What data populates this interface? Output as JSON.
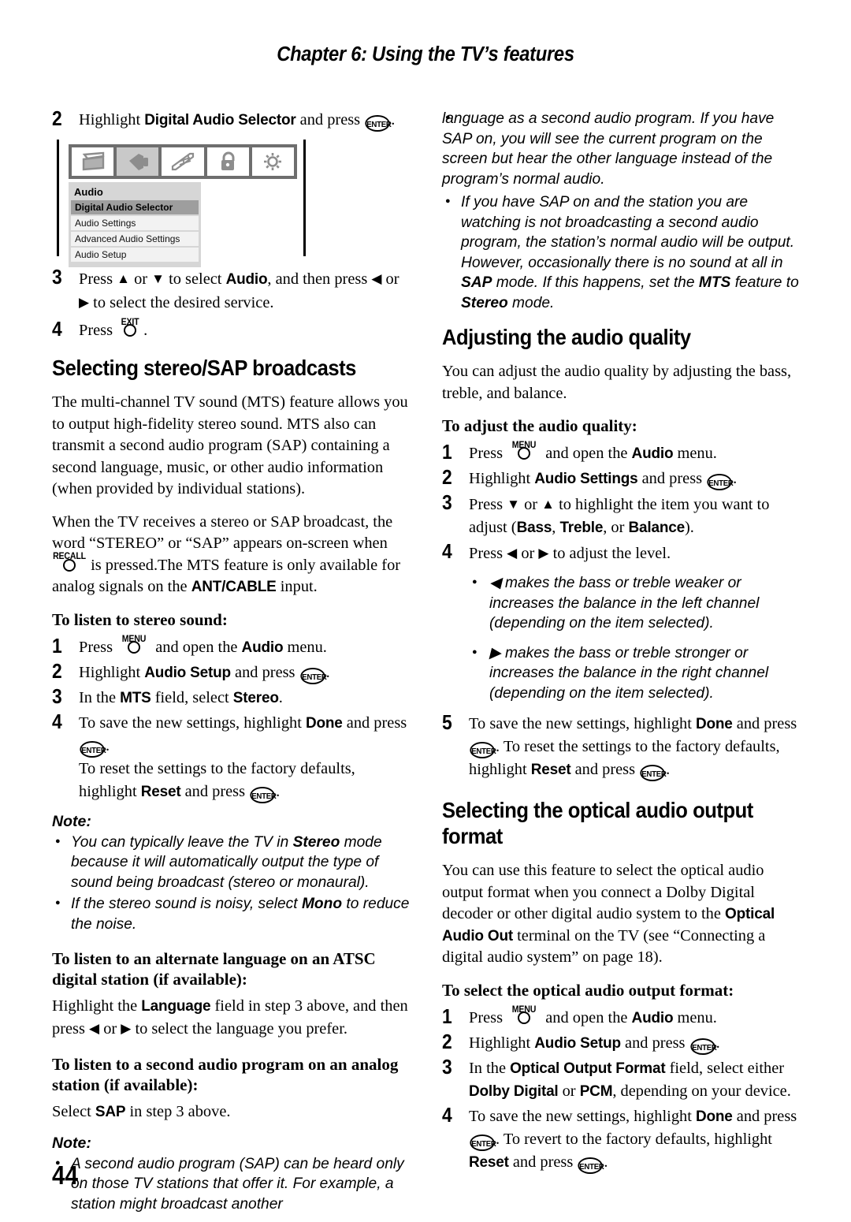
{
  "header": {
    "chapter_title": "Chapter 6: Using the TV’s features"
  },
  "page_number": "44",
  "left_column": {
    "step2": {
      "num": "2",
      "text_before": "Highlight ",
      "bold": "Digital Audio Selector",
      "text_after": " and press ",
      "key": "ENTER",
      "end": "."
    },
    "figure": {
      "name": "tv-audio-menu-screenshot",
      "icons": [
        "picture-icon",
        "audio-speaker-icon",
        "settings-sliders-icon",
        "lock-icon",
        "brightness-sun-icon"
      ],
      "selected_icon_index": 1,
      "menu_title": "Audio",
      "menu_items": [
        "Digital Audio Selector",
        "Audio Settings",
        "Advanced Audio Settings",
        "Audio Setup"
      ],
      "highlighted_item": "Digital Audio Selector"
    },
    "step3": {
      "num": "3",
      "p1": "Press ",
      "p2": " or ",
      "p3": " to select ",
      "bold1": "Audio",
      "p4": ", and then press ",
      "p5": " or ",
      "p6": " to select the desired service."
    },
    "step4": {
      "num": "4",
      "text": "Press ",
      "key": "EXIT",
      "end": "."
    },
    "heading_stereo_sap": "Selecting stereo/SAP broadcasts",
    "para1": "The multi-channel TV sound (MTS) feature allows you to output high-fidelity stereo sound. MTS also can transmit a second audio program (SAP) containing a second language, music, or other audio information (when provided by individual stations).",
    "para2_a": "When the TV receives a stereo or SAP broadcast, the word “STEREO” or “SAP” appears on-screen when ",
    "para2_key": "RECALL",
    "para2_b": " is pressed.The MTS feature is only available for analog signals on the ",
    "para2_bold": "ANT/CABLE",
    "para2_c": " input.",
    "sub_listen_stereo": "To listen to stereo sound:",
    "stereo_steps": [
      {
        "num": "1",
        "a": "Press ",
        "key": "MENU",
        "b": " and open the ",
        "bold": "Audio",
        "c": " menu."
      },
      {
        "num": "2",
        "a": "Highlight ",
        "bold": "Audio Setup",
        "b": " and press ",
        "key": "ENTER",
        "c": "."
      },
      {
        "num": "3",
        "a": "In the ",
        "bold": "MTS",
        "b": " field, select ",
        "bold2": "Stereo",
        "c": "."
      },
      {
        "num": "4",
        "a": "To save the new settings, highlight ",
        "bold": "Done",
        "b": " and press ",
        "key": "ENTER",
        "c": ".",
        "d": "To reset the settings to the factory defaults, highlight ",
        "bold2": "Reset",
        "e": " and press ",
        "key2": "ENTER",
        "f": "."
      }
    ],
    "note1_label": "Note:",
    "note1_bullets": [
      {
        "a": "You can typically leave the TV in ",
        "b": "Stereo",
        "c": " mode because it will automatically output the type of sound being broadcast (stereo or monaural)."
      },
      {
        "a": "If the stereo sound is noisy, select ",
        "b": "Mono",
        "c": " to reduce the noise."
      }
    ],
    "sub_alt_language": "To listen to an alternate language on an ATSC digital station (if available):",
    "alt_language_body_a": "Highlight the ",
    "alt_language_bold": "Language",
    "alt_language_body_b": " field in step 3 above, and then press ",
    "alt_language_body_c": " or ",
    "alt_language_body_d": " to select the language you prefer.",
    "sub_second_audio": "To listen to a second audio program on an analog station (if available):",
    "second_audio_a": "Select ",
    "second_audio_bold": "SAP",
    "second_audio_b": " in step 3 above.",
    "note2_label": "Note:",
    "note2_bullet": "A second audio program (SAP) can be heard only on those TV stations that offer it. For example, a station might broadcast another"
  },
  "right_column": {
    "continued_para": "language as a second audio program. If you have SAP on, you will see the current program on the screen but hear the other language instead of the program’s normal audio.",
    "bullet_sap": {
      "a": "If you have SAP on and the station you are watching is not broadcasting a second audio program, the station’s normal audio will be output. However, occasionally there is no sound at all in ",
      "b": "SAP",
      "c": " mode. If this happens, set the ",
      "d": "MTS",
      "e": " feature to ",
      "f": "Stereo",
      "g": " mode."
    },
    "heading_audio_quality": "Adjusting the audio quality",
    "para_audio_quality": "You can adjust the audio quality by adjusting the bass, treble, and balance.",
    "sub_adjust": "To adjust the audio quality:",
    "adjust_steps": [
      {
        "num": "1",
        "a": "Press ",
        "key": "MENU",
        "b": " and open the ",
        "bold": "Audio",
        "c": " menu."
      },
      {
        "num": "2",
        "a": "Highlight ",
        "bold": "Audio Settings",
        "b": " and press ",
        "key": "ENTER",
        "c": "."
      },
      {
        "num": "3",
        "a": "Press ",
        "b": " or ",
        "c": " to highlight the item you want to adjust (",
        "bold": "Bass",
        "sep1": ", ",
        "bold2": "Treble",
        "sep2": ", or ",
        "bold3": "Balance",
        "d": ")."
      },
      {
        "num": "4",
        "a": "Press ",
        "b": " or ",
        "c": " to adjust the level."
      },
      {
        "num": "5",
        "a": "To save the new settings, highlight ",
        "bold": "Done",
        "b": " and press ",
        "key": "ENTER",
        "c": ". To reset the settings to the factory defaults, highlight ",
        "bold2": "Reset",
        "d": " and press ",
        "key2": "ENTER",
        "e": "."
      }
    ],
    "adjust_bullets": [
      {
        "arrow": "left",
        "text": " makes the bass or treble weaker or increases the balance in the left channel (depending on the item selected)."
      },
      {
        "arrow": "right",
        "text": " makes the bass or treble stronger or increases the balance in the right channel (depending on the item selected)."
      }
    ],
    "heading_optical": "Selecting the optical audio output format",
    "para_optical_a": "You can use this feature to select the optical audio output format when you connect a Dolby Digital decoder or other digital audio system to the ",
    "para_optical_bold": "Optical Audio Out",
    "para_optical_b": " terminal on the TV (see “Connecting a digital audio system” on page 18).",
    "sub_optical": "To select the optical audio output format:",
    "optical_steps": [
      {
        "num": "1",
        "a": "Press ",
        "key": "MENU",
        "b": " and open the ",
        "bold": "Audio",
        "c": " menu."
      },
      {
        "num": "2",
        "a": "Highlight ",
        "bold": "Audio Setup",
        "b": " and press ",
        "key": "ENTER",
        "c": "."
      },
      {
        "num": "3",
        "a": "In the ",
        "bold": "Optical Output Format",
        "b": " field, select either ",
        "bold2": "Dolby Digital",
        "c": " or ",
        "bold3": "PCM",
        "d": ", depending on your device."
      },
      {
        "num": "4",
        "a": "To save the new settings, highlight ",
        "bold": "Done",
        "b": " and press ",
        "key": "ENTER",
        "c": ". To revert to the factory defaults, highlight ",
        "bold2": "Reset",
        "d": " and press ",
        "key2": "ENTER",
        "e": "."
      }
    ]
  },
  "glyphs": {
    "arrow_up": "▲",
    "arrow_down": "▼",
    "arrow_left": "◀",
    "arrow_right": "▶"
  },
  "colors": {
    "text": "#000000",
    "menu_bar": "#6e6e6e",
    "menu_bg": "#d6d6d6",
    "menu_row": "#f2f2f2",
    "menu_row_highlight": "#9e9e9e",
    "menu_icon_selected": "#c9c9c9"
  }
}
